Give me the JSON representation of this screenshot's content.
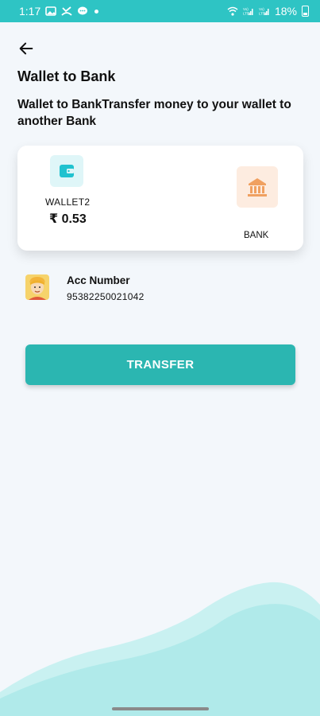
{
  "status_bar": {
    "time": "1:17",
    "battery_percent": "18%",
    "left_icons": [
      "gallery-icon",
      "missed-call-icon",
      "message-icon"
    ],
    "right_icons": [
      "wifi-icon",
      "volte-signal-icon",
      "volte-signal-icon-2",
      "battery-icon"
    ],
    "network_label_1": "Vo) LTE1",
    "network_label_2": "Vo) LTE2"
  },
  "header": {
    "title": "Wallet to Bank",
    "description": "Wallet to BankTransfer money to your wallet to another Bank"
  },
  "card": {
    "wallet_name": "WALLET2",
    "wallet_balance": "₹ 0.53",
    "bank_label": "BANK"
  },
  "account": {
    "label": "Acc Number",
    "number": "95382250021042"
  },
  "actions": {
    "transfer_label": "TRANSFER"
  },
  "colors": {
    "accent": "#2ec4c4",
    "button": "#2bb6b1",
    "wallet_icon_bg": "#dff6f8",
    "bank_icon_bg": "#fdece0",
    "bank_icon": "#f0a060",
    "wave": "#b6ecec"
  }
}
